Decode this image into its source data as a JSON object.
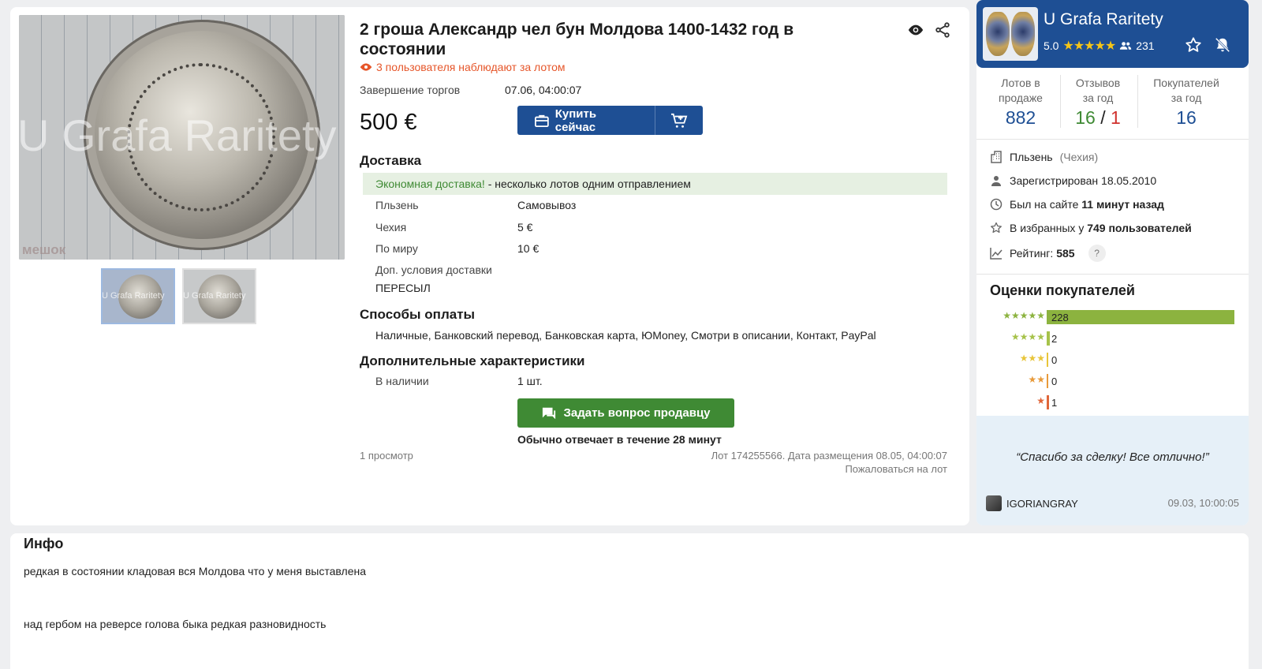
{
  "gallery": {
    "watermark": "U Grafa Raritety",
    "site_mark": "мешок",
    "thumb_watermark": "U Grafa Raritety"
  },
  "lot": {
    "title": "2 гроша Александр чел бун Молдова 1400-1432 год в состоянии",
    "watchers": "3 пользователя наблюдают за лотом",
    "end_label": "Завершение торгов",
    "end_value": "07.06, 04:00:07",
    "price": "500 €",
    "buy_label": "Купить сейчас",
    "delivery": {
      "heading": "Доставка",
      "promo_green": "Экономная доставка!",
      "promo_rest": " - несколько лотов одним отправлением",
      "rows": [
        {
          "label": "Пльзень",
          "value": "Самовывоз"
        },
        {
          "label": "Чехия",
          "value": "5 €"
        },
        {
          "label": "По миру",
          "value": "10 €"
        }
      ],
      "extra_label": "Доп. условия доставки",
      "extra_value": "ПЕРЕСЫЛ"
    },
    "payment": {
      "heading": "Способы оплаты",
      "methods": "Наличные, Банковский перевод, Банковская карта, ЮMoney, Смотри в описании, Контакт, PayPal"
    },
    "extra": {
      "heading": "Дополнительные характеристики",
      "stock_label": "В наличии",
      "stock_value": "1 шт."
    },
    "ask_label": "Задать вопрос продавцу",
    "reply_note": "Обычно отвечает в течение 28 минут",
    "views": "1 просмотр",
    "meta": "Лот 174255566. Дата размещения 08.05, 04:00:07",
    "complain": "Пожаловаться на лот"
  },
  "seller": {
    "name": "U Grafa Raritety",
    "rating": "5.0",
    "stars": "★★★★★",
    "followers": "231",
    "stats": {
      "lots_label_1": "Лотов в",
      "lots_label_2": "продаже",
      "lots_value": "882",
      "reviews_label_1": "Отзывов",
      "reviews_label_2": "за год",
      "reviews_pos": "16",
      "reviews_sep": "/",
      "reviews_neg": "1",
      "buyers_label_1": "Покупателей",
      "buyers_label_2": "за год",
      "buyers_value": "16"
    },
    "city": "Пльзень",
    "country": "(Чехия)",
    "registered_label": "Зарегистрирован ",
    "registered_date": "18.05.2010",
    "online_label": "Был на сайте ",
    "online_value": "11 минут назад",
    "fav_label": "В избранных у ",
    "fav_value": "749 пользователей",
    "score_label": "Рейтинг: ",
    "score_value": "585",
    "help": "?"
  },
  "buyer_ratings": {
    "heading": "Оценки покупателей",
    "rows": [
      {
        "stars": "★★★★★",
        "count": 228,
        "color": "#8cb33f"
      },
      {
        "stars": "★★★★",
        "count": 2,
        "color": "#a6c24a"
      },
      {
        "stars": "★★★",
        "count": 0,
        "color": "#e8c53a"
      },
      {
        "stars": "★★",
        "count": 0,
        "color": "#e89a3a"
      },
      {
        "stars": "★",
        "count": 1,
        "color": "#e0663a"
      }
    ]
  },
  "review": {
    "text": "“Спасибо за сделку! Все отлично!”",
    "author": "IGORIANGRAY",
    "date": "09.03, 10:00:05"
  },
  "info": {
    "heading": "Инфо",
    "line1": "редкая в состоянии кладовая вся Молдова что у меня выставлена",
    "line2": "над гербом на реверсе голова быка редкая разновидность"
  },
  "colors": {
    "brand_blue": "#1e4f94",
    "action_green": "#3f8a34",
    "watch_orange": "#e6562a",
    "star_gold": "#f5c518"
  }
}
